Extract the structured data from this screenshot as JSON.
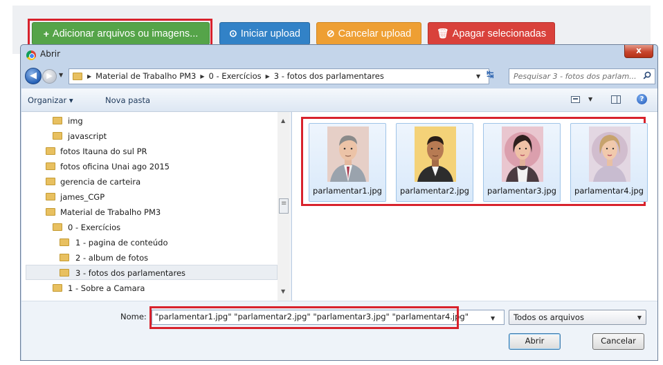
{
  "web_toolbar": {
    "add_label": "Adicionar arquivos ou imagens...",
    "add_icon": "+",
    "start_label": "Iniciar upload",
    "cancel_label": "Cancelar upload",
    "delete_label": "Apagar selecionadas",
    "colors": {
      "add": "#55a449",
      "start": "#3282c7",
      "cancel": "#ee9f33",
      "delete": "#d9413b",
      "highlight": "#d8222c"
    }
  },
  "dialog": {
    "title": "Abrir",
    "close_label": "x",
    "breadcrumb": [
      "Material de Trabalho PM3",
      "0 - Exercícios",
      "3 - fotos dos parlamentares"
    ],
    "search_placeholder": "Pesquisar 3 - fotos dos parlam...",
    "toolbar": {
      "organize": "Organizar ▾",
      "new_folder": "Nova pasta",
      "help": "?"
    },
    "tree": [
      {
        "label": "img"
      },
      {
        "label": "javascript"
      },
      {
        "label": "fotos Itauna do sul PR"
      },
      {
        "label": "fotos oficina Unai ago 2015"
      },
      {
        "label": "gerencia de carteira"
      },
      {
        "label": "james_CGP"
      },
      {
        "label": "Material de Trabalho PM3"
      },
      {
        "label": "0 - Exercícios"
      },
      {
        "label": "1 - pagina de conteúdo"
      },
      {
        "label": "2 - album de fotos"
      },
      {
        "label": "3 - fotos dos parlamentares",
        "selected": true
      },
      {
        "label": "1 - Sobre a Camara"
      }
    ],
    "files": [
      {
        "name": "parlamentar1.jpg",
        "icon": "portrait-man-tie-icon"
      },
      {
        "name": "parlamentar2.jpg",
        "icon": "portrait-man-icon"
      },
      {
        "name": "parlamentar3.jpg",
        "icon": "portrait-woman-icon"
      },
      {
        "name": "parlamentar4.jpg",
        "icon": "portrait-woman-blonde-icon"
      }
    ],
    "filename_label": "Nome:",
    "filename_value": "\"parlamentar1.jpg\" \"parlamentar2.jpg\" \"parlamentar3.jpg\" \"parlamentar4.jpg\"",
    "filetype": "Todos os arquivos",
    "open_button": "Abrir",
    "cancel_button": "Cancelar"
  }
}
